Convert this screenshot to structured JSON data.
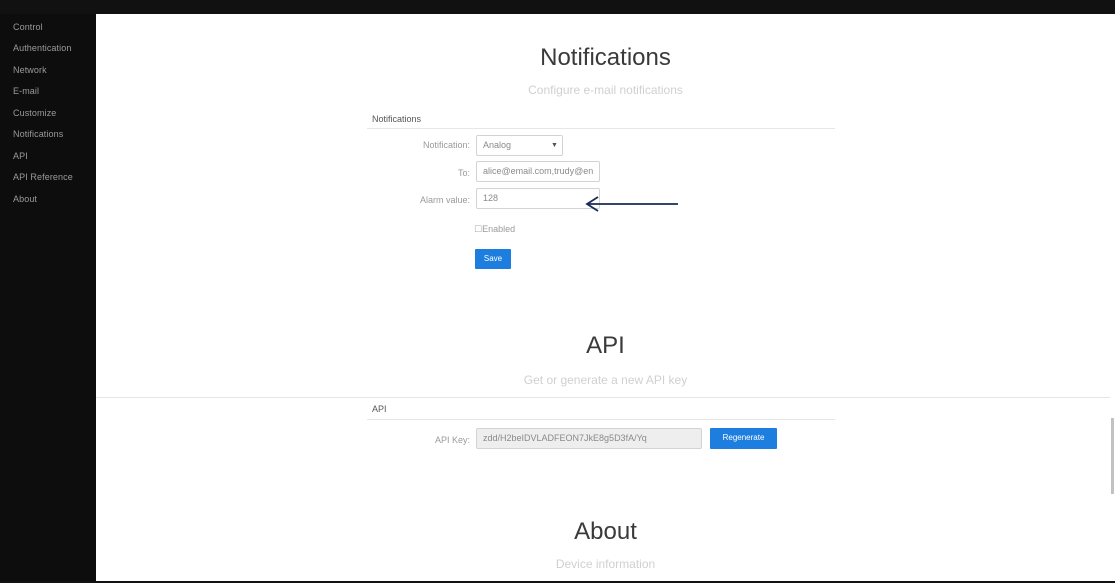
{
  "sidebar": {
    "items": [
      {
        "label": "Control"
      },
      {
        "label": "Authentication"
      },
      {
        "label": "Network"
      },
      {
        "label": "E-mail"
      },
      {
        "label": "Customize"
      },
      {
        "label": "Notifications"
      },
      {
        "label": "API"
      },
      {
        "label": "API Reference"
      },
      {
        "label": "About"
      }
    ]
  },
  "notifications": {
    "title": "Notifications",
    "subtitle": "Configure e-mail notifications",
    "panel_heading": "Notifications",
    "notification_label": "Notification:",
    "notification_value": "Analog",
    "to_label": "To:",
    "to_value": "alice@email.com,trudy@en",
    "alarm_label": "Alarm value:",
    "alarm_value": "128",
    "enabled_label": "Enabled",
    "save_label": "Save"
  },
  "api": {
    "title": "API",
    "subtitle": "Get or generate a new API key",
    "panel_heading": "API",
    "key_label": "API Key:",
    "key_value": "zdd/H2beIDVLADFEON7JkE8g5D3fA/Yq",
    "regenerate_label": "Regenerate"
  },
  "about": {
    "title": "About",
    "subtitle": "Device information"
  },
  "colors": {
    "sidebar_bg": "#0d0d0d",
    "accent": "#1d7ee0",
    "annotation_arrow": "#1a2a5a"
  }
}
